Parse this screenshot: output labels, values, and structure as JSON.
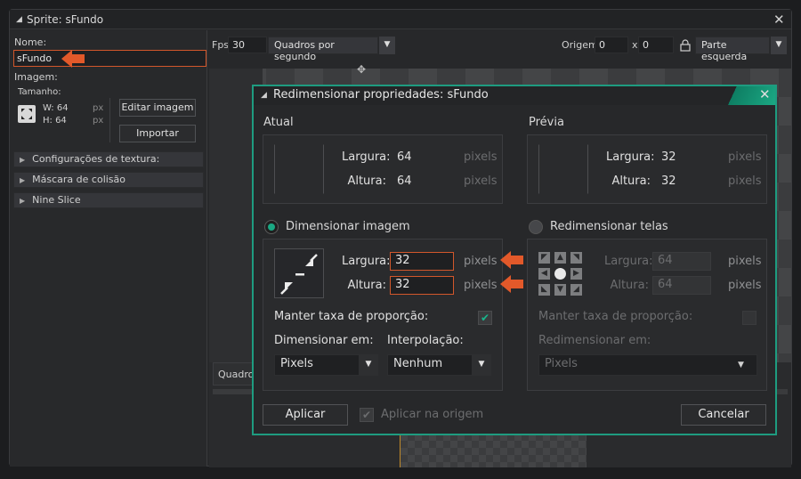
{
  "window": {
    "title": "Sprite: sFundo",
    "close_glyph": "✕"
  },
  "left_panel": {
    "name_label": "Nome:",
    "name_value": "sFundo",
    "image_label": "Imagem:",
    "size_label": "Tamanho:",
    "width_text": "W: 64",
    "height_text": "H: 64",
    "unit": "px",
    "edit_image_button": "Editar imagem",
    "import_button": "Importar",
    "sections": [
      "Configurações de textura:",
      "Máscara de colisão",
      "Nine Slice"
    ]
  },
  "toolbar": {
    "fps_label": "Fps",
    "fps_value": "30",
    "fps_mode": "Quadros por segundo",
    "origin_label": "Origem",
    "origin_x": "0",
    "origin_x_label": "x",
    "origin_y": "0",
    "origin_mode": "Parte esquerda"
  },
  "frames_label": "Quadro",
  "dialog": {
    "title": "Redimensionar propriedades: sFundo",
    "current": {
      "header": "Atual",
      "width_label": "Largura:",
      "width_value": "64",
      "height_label": "Altura:",
      "height_value": "64",
      "unit": "pixels"
    },
    "preview": {
      "header": "Prévia",
      "width_label": "Largura:",
      "width_value": "32",
      "height_label": "Altura:",
      "height_value": "32",
      "unit": "pixels"
    },
    "scale_image": {
      "radio_label": "Dimensionar imagem",
      "width_label": "Largura:",
      "width_value": "32",
      "height_label": "Altura:",
      "height_value": "32",
      "unit": "pixels",
      "keep_ratio_label": "Manter taxa de proporção:",
      "scale_in_label": "Dimensionar em:",
      "scale_in_value": "Pixels",
      "interp_label": "Interpolação:",
      "interp_value": "Nenhum"
    },
    "resize_canvas": {
      "radio_label": "Redimensionar telas",
      "width_label": "Largura:",
      "width_value": "64",
      "height_label": "Altura:",
      "height_value": "64",
      "unit": "pixels",
      "keep_ratio_label": "Manter taxa de proporção:",
      "resize_in_label": "Redimensionar em:",
      "resize_in_value": "Pixels"
    },
    "apply_button": "Aplicar",
    "apply_origin_label": "Aplicar na origem",
    "cancel_button": "Cancelar"
  },
  "colors": {
    "accent": "#1aa883",
    "highlight": "#d2572b",
    "arrow": "#e2592a"
  }
}
